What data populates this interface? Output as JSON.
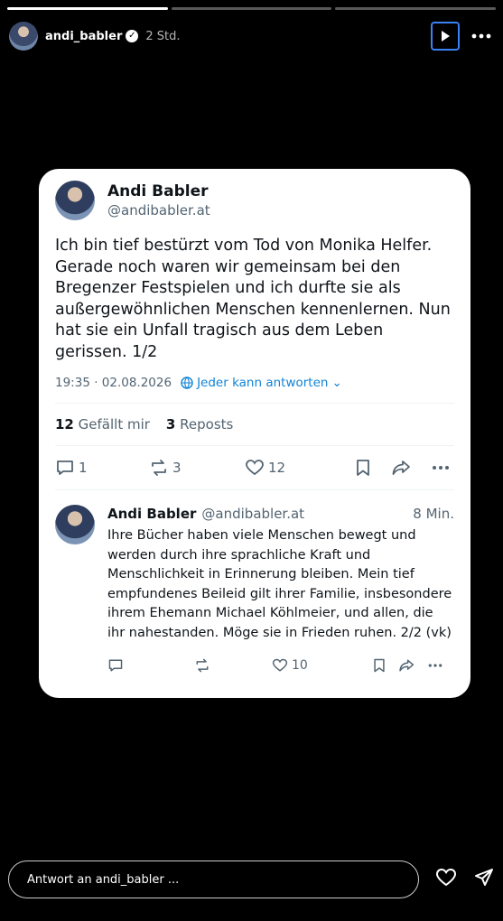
{
  "story": {
    "progress": [
      1.0,
      0.0,
      0.0
    ],
    "username": "andi_babler",
    "time": "2 Std.",
    "icons": {
      "verified": "verified-badge-icon",
      "play": "play-icon",
      "more": "more-icon"
    }
  },
  "post": {
    "name": "Andi Babler",
    "handle": "@andibabler.at",
    "text": "Ich bin tief bestürzt vom Tod von Monika Helfer. Gerade noch waren wir gemeinsam bei den Bregenzer Festspielen und ich durfte sie als außergewöhnlichen Menschen kennenlernen. Nun hat sie ein Unfall tragisch aus dem Leben gerissen. 1/2",
    "timestamp": "19:35 · 02.08.2026",
    "reply_setting": "Jeder kann antworten",
    "likes_count": "12",
    "likes_label": "Gefällt mir",
    "reposts_count": "3",
    "reposts_label": "Reposts",
    "actions": {
      "replies": "1",
      "reposts": "3",
      "likes": "12"
    }
  },
  "reply": {
    "name": "Andi Babler",
    "handle": "@andibabler.at",
    "time": "8 Min.",
    "text": "Ihre Bücher haben viele Menschen bewegt und werden durch ihre sprachliche Kraft und Menschlichkeit in Erinnerung bleiben. Mein tief empfundenes Beileid gilt ihrer Familie, insbesondere ihrem Ehemann Michael Köhlmeier, und allen, die ihr nahestanden. Möge sie in Frieden ruhen. 2/2 (vk)",
    "likes": "10"
  },
  "bottom": {
    "placeholder": "Antwort an andi_babler ..."
  },
  "colors": {
    "accent": "#1083d6",
    "focus": "#3b82f6",
    "text": "#0f1419",
    "muted": "#536471"
  }
}
